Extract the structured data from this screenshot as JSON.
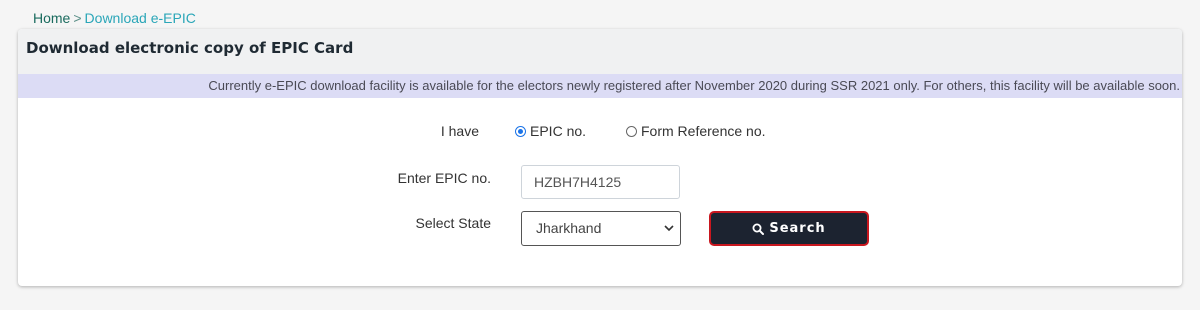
{
  "breadcrumb": {
    "home": "Home",
    "separator": ">",
    "current": "Download e-EPIC"
  },
  "card": {
    "title": "Download electronic copy of EPIC Card",
    "notice": "Currently e-EPIC download facility is available for the electors newly registered after November 2020 during SSR 2021 only. For others, this facility will be available soon."
  },
  "form": {
    "i_have_label": "I have",
    "radio_epic_label": "EPIC no.",
    "radio_form_label": "Form Reference no.",
    "selected_option": "EPIC no.",
    "epic_label": "Enter EPIC no.",
    "epic_value": "HZBH7H4125",
    "state_label": "Select State",
    "state_value": "Jharkhand",
    "search_label": "Search"
  },
  "colors": {
    "breadcrumb_home": "#1a6b5e",
    "breadcrumb_current": "#2aa6b8",
    "notice_bg": "#dcdcf5",
    "button_bg": "#1c2330",
    "button_border": "#c8171f",
    "radio_checked": "#1a73e8"
  },
  "icons": {
    "search": "search-icon",
    "select": "chevron-down-icon"
  }
}
